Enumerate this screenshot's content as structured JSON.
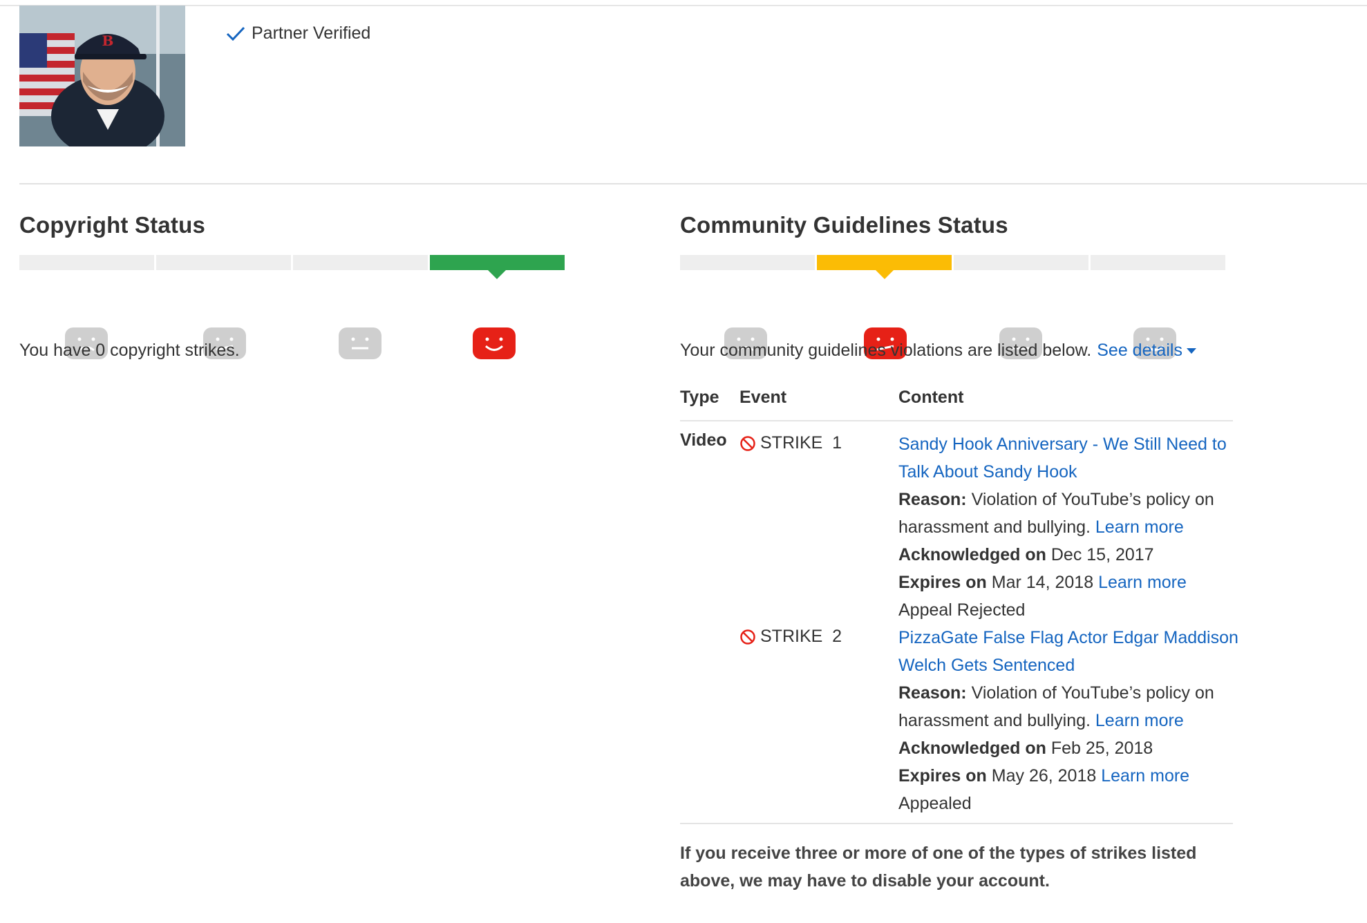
{
  "header": {
    "partner_status": "Partner Verified",
    "accent_color": "#1565c0"
  },
  "copyright": {
    "title": "Copyright Status",
    "active_level": 4,
    "active_color": "#2ea44f",
    "faces": [
      "sad-face-icon",
      "meh-face-icon",
      "neutral-face-icon",
      "happy-face-icon"
    ],
    "message": "You have 0 copyright strikes."
  },
  "community": {
    "title": "Community Guidelines Status",
    "active_level": 2,
    "active_color": "#fbbc05",
    "faces": [
      "sad-face-icon",
      "meh-face-icon",
      "neutral-face-icon",
      "happy-face-icon"
    ],
    "message": "Your community guidelines violations are listed below.",
    "see_details_label": "See details",
    "table": {
      "headers": {
        "type": "Type",
        "event": "Event",
        "content": "Content"
      },
      "rows": [
        {
          "type": "Video",
          "event": "STRIKE  1",
          "title": "Sandy Hook Anniversary - We Still Need to Talk About Sandy Hook",
          "reason_label": "Reason:",
          "reason_text": "Violation of YouTube’s policy on harassment and bullying.",
          "learn_more": "Learn more",
          "acknowledged_label": "Acknowledged on",
          "acknowledged_date": "Dec 15, 2017",
          "expires_label": "Expires on",
          "expires_date": "Mar 14, 2018",
          "expires_learn_more": "Learn more",
          "appeal_status": "Appeal Rejected"
        },
        {
          "type": "",
          "event": "STRIKE  2",
          "title": "PizzaGate False Flag Actor Edgar Maddison Welch Gets Sentenced",
          "reason_label": "Reason:",
          "reason_text": "Violation of YouTube’s policy on harassment and bullying.",
          "learn_more": "Learn more",
          "acknowledged_label": "Acknowledged on",
          "acknowledged_date": "Feb 25, 2018",
          "expires_label": "Expires on",
          "expires_date": "May 26, 2018",
          "expires_learn_more": "Learn more",
          "appeal_status": "Appealed"
        }
      ]
    },
    "footnote": "If you receive three or more of one of the types of strikes listed above, we may have to disable your account."
  }
}
